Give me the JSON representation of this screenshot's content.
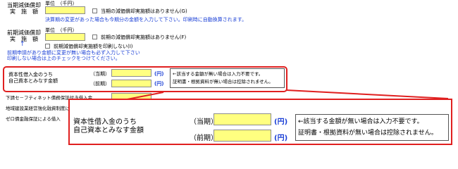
{
  "section1": {
    "label_line1": "当期減価償却",
    "label_line2": "実　施　額",
    "unit": "単位　（千円）",
    "checkbox_label": "当期の減価償却実施額はありません(G)",
    "note": "決算期の変更があった場合も今期分の金額を入力して下さい。印刷時に自動換算されます。"
  },
  "section2": {
    "label_line1": "前期減価償却",
    "label_line2": "実　施　額",
    "unit": "単位　（千円）",
    "checkbox_label": "前期の減価償却実施額はありません(F)",
    "arrow": "↑",
    "print_checkbox_label": "前期減価償却実施額を印刷しない(I)",
    "note_line1": "前期申請があり金額に変更が無い場合も必ず入力して下さい",
    "note_line2": "印刷しない場合は上のチェックをつけてください。"
  },
  "capital": {
    "label_line1": "資本性借入金のうち",
    "label_line2": "自己資本とみなす金額",
    "current_label": "（当期）",
    "previous_label": "（前期）",
    "current_value": "",
    "previous_value": "",
    "unit": "(円)",
    "note_line1": "←該当する金額が無い場合は入力不要です。",
    "note_line2": "証明書・根拠資料が無い場合は控除されません。"
  },
  "other_rows": [
    "下請セ－フティネット債務保証付き借入金",
    "地域建設業経営強化融資制度による借入金",
    "ゼロ債金融保証による借入"
  ],
  "zoom": {
    "label_line1": "資本性借入金のうち",
    "label_line2": "自己資本とみなす金額",
    "current_label": "（当期）",
    "previous_label": "（前期）",
    "current_value": "",
    "previous_value": "",
    "unit": "(円)",
    "note_line1": "←該当する金額が無い場合は入力不要です。",
    "note_line2": "証明書・根拠資料が無い場合は控除されません。"
  },
  "colors": {
    "input_bg": "#ffff80",
    "highlight": "#e02020",
    "link_blue": "#1a3fd6"
  }
}
